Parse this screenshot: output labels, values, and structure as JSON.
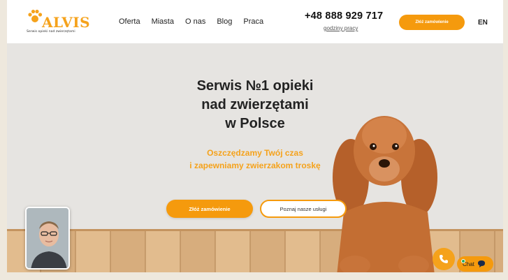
{
  "header": {
    "logo_text": "ALVIS",
    "logo_tagline": "Serwis opieki nad zwierzętami",
    "nav": [
      "Oferta",
      "Miasta",
      "O nas",
      "Blog",
      "Praca"
    ],
    "phone": "+48 888 929 717",
    "hours_link": "godziny pracy",
    "order_button": "Złóż zamówienie",
    "language": "EN"
  },
  "hero": {
    "title_lines": [
      "Serwis №1 opieki",
      "nad zwierzętami",
      "w Polsce"
    ],
    "subtitle_lines": [
      "Oszczędzamy Twój czas",
      "i zapewniamy zwierzakom troskę"
    ],
    "order_button": "Złóż zamówienie",
    "services_button": "Poznaj nasze usługi"
  },
  "chat": {
    "label": "Chat"
  },
  "colors": {
    "accent": "#f59a0d",
    "hero_bg": "#e6e4e1",
    "text": "#222222"
  }
}
